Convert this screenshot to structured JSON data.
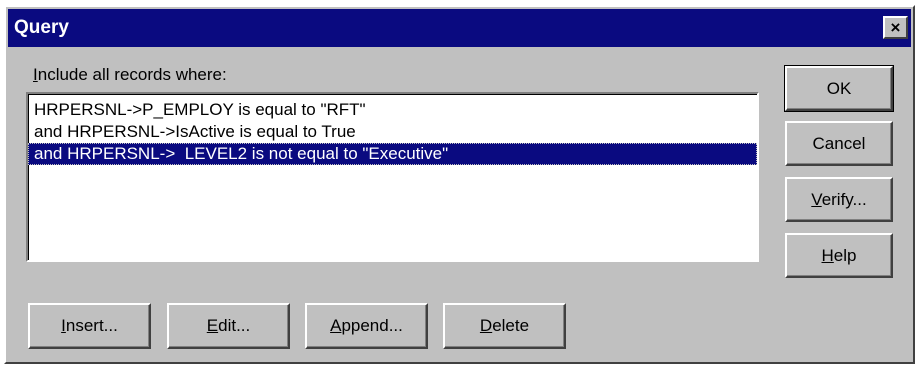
{
  "window": {
    "title": "Query",
    "close_glyph": "×"
  },
  "criteria": {
    "label": "Include all records where:",
    "items": [
      {
        "text": "HRPERSNL->P_EMPLOY is equal to \"RFT\"",
        "selected": false
      },
      {
        "text": "and HRPERSNL->IsActive is equal to True",
        "selected": false
      },
      {
        "text": "and HRPERSNL->  LEVEL2 is not equal to \"Executive\"",
        "selected": true
      }
    ]
  },
  "buttons": {
    "ok": {
      "label": "OK",
      "mnemonic_index": -1
    },
    "cancel": {
      "label": "Cancel",
      "mnemonic_index": -1
    },
    "verify": {
      "label": "Verify...",
      "mnemonic_index": 0
    },
    "help": {
      "label": "Help",
      "mnemonic_index": 0
    },
    "insert": {
      "label": "Insert...",
      "mnemonic_index": 0
    },
    "edit": {
      "label": "Edit...",
      "mnemonic_index": 0
    },
    "append": {
      "label": "Append...",
      "mnemonic_index": 0
    },
    "delete": {
      "label": "Delete",
      "mnemonic_index": 0
    }
  },
  "colors": {
    "titlebar": "#0a0a80",
    "face": "#c0c0c0",
    "selection": "#0a0a80"
  }
}
